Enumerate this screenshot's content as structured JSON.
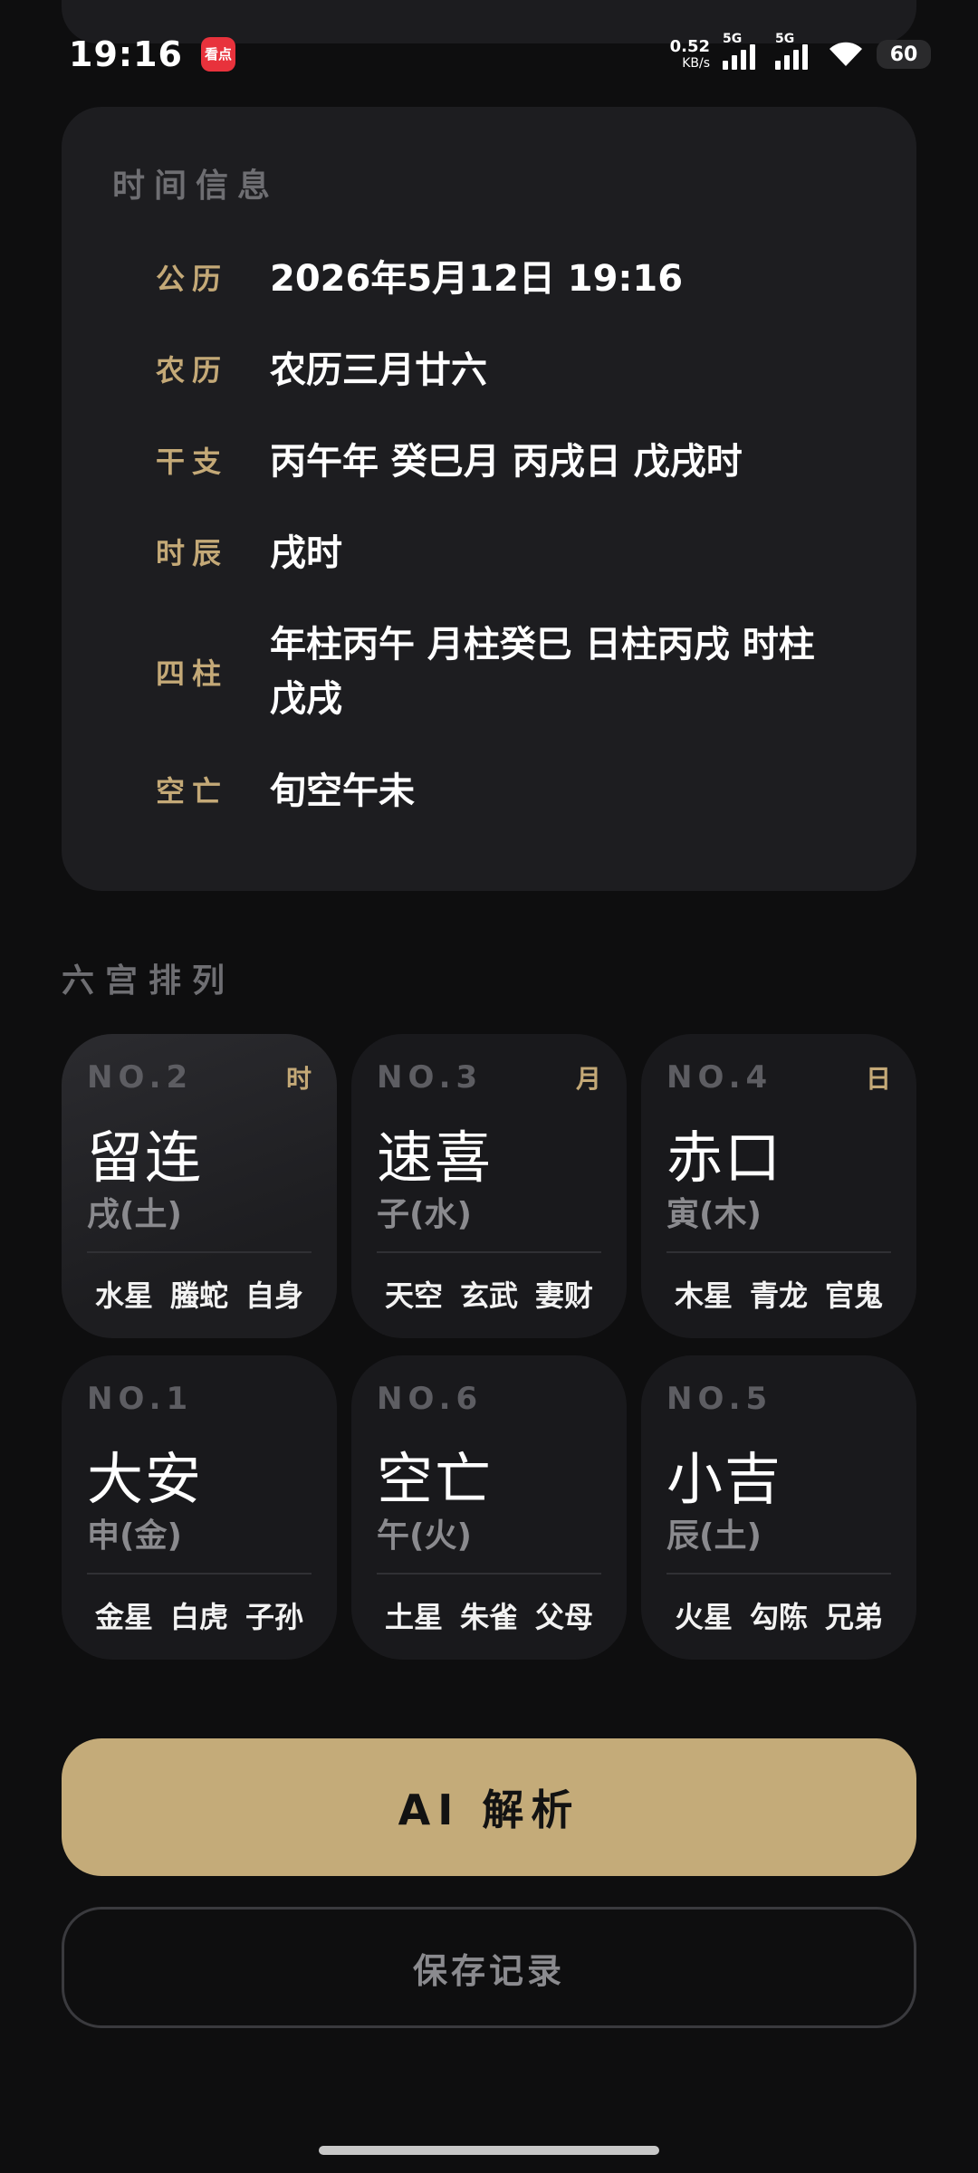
{
  "status_bar": {
    "time": "19:16",
    "app_badge": "看点",
    "net_speed_value": "0.52",
    "net_speed_unit": "KB/s",
    "sim1_tag": "5G",
    "sim2_tag": "5G",
    "battery": "60",
    "icons": [
      "signal-icon",
      "wifi-icon",
      "battery-icon"
    ]
  },
  "time_info": {
    "title": "时间信息",
    "rows": [
      {
        "label": "公历",
        "value": "2026年5月12日 19:16"
      },
      {
        "label": "农历",
        "value": "农历三月廿六"
      },
      {
        "label": "干支",
        "value": "丙午年 癸巳月 丙戌日 戊戌时"
      },
      {
        "label": "时辰",
        "value": "戌时"
      },
      {
        "label": "四柱",
        "value": "年柱丙午 月柱癸巳 日柱丙戌 时柱戊戌"
      },
      {
        "label": "空亡",
        "value": "旬空午未"
      }
    ]
  },
  "palaces": {
    "title": "六宫排列",
    "items": [
      {
        "no": "NO.2",
        "pillar": "时",
        "name": "留连",
        "element": "戌(土)",
        "meta": [
          "水星",
          "螣蛇",
          "自身"
        ],
        "active": true
      },
      {
        "no": "NO.3",
        "pillar": "月",
        "name": "速喜",
        "element": "子(水)",
        "meta": [
          "天空",
          "玄武",
          "妻财"
        ],
        "active": false
      },
      {
        "no": "NO.4",
        "pillar": "日",
        "name": "赤口",
        "element": "寅(木)",
        "meta": [
          "木星",
          "青龙",
          "官鬼"
        ],
        "active": false
      },
      {
        "no": "NO.1",
        "pillar": "",
        "name": "大安",
        "element": "申(金)",
        "meta": [
          "金星",
          "白虎",
          "子孙"
        ],
        "active": false
      },
      {
        "no": "NO.6",
        "pillar": "",
        "name": "空亡",
        "element": "午(火)",
        "meta": [
          "土星",
          "朱雀",
          "父母"
        ],
        "active": false
      },
      {
        "no": "NO.5",
        "pillar": "",
        "name": "小吉",
        "element": "辰(土)",
        "meta": [
          "火星",
          "勾陈",
          "兄弟"
        ],
        "active": false
      }
    ]
  },
  "actions": {
    "ai_label": "AI 解析",
    "save_label": "保存记录"
  },
  "colors": {
    "background": "#0e0e0f",
    "card": "#1d1d20",
    "accent_gold": "#c4a977",
    "button_gold": "#c4ab79",
    "muted_text": "#6e6e72"
  }
}
